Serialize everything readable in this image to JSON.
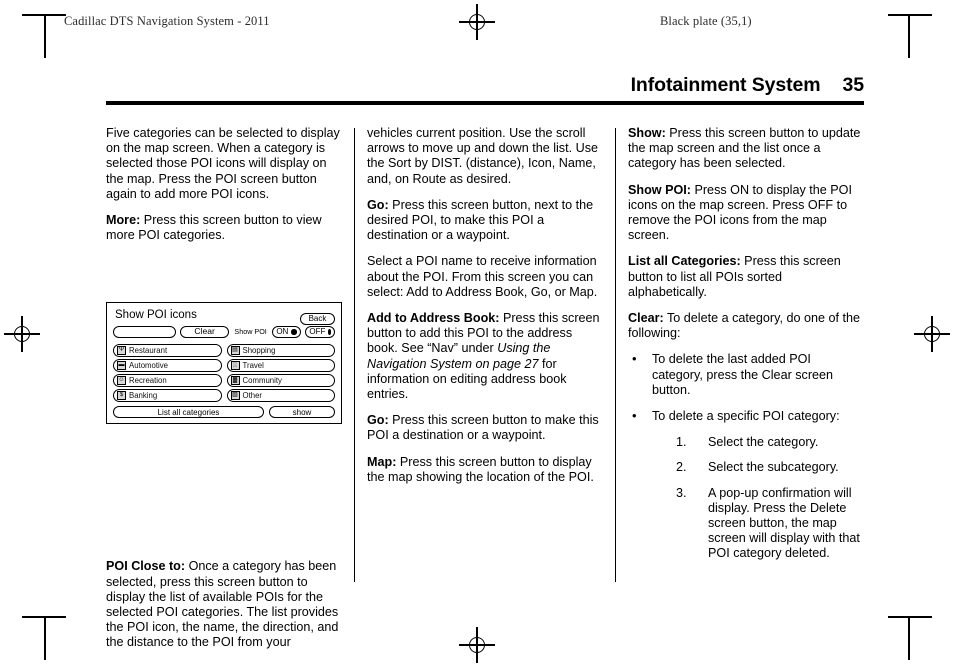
{
  "page": {
    "running_head_left": "Cadillac DTS Navigation System - 2011",
    "running_head_right": "Black plate (35,1)",
    "section_title": "Infotainment System",
    "page_number": "35"
  },
  "figure": {
    "screen_title": "Show POI icons",
    "back_button": "Back",
    "blank_field": "",
    "clear_button": "Clear",
    "show_poi_label": "Show POI",
    "on_button": "ON",
    "off_button": "OFF",
    "categories": [
      {
        "label": "Restaurant",
        "icon": "restaurant-icon",
        "glyph": "Ψ"
      },
      {
        "label": "Shopping",
        "icon": "shopping-icon",
        "glyph": "▤"
      },
      {
        "label": "Automotive",
        "icon": "automotive-icon",
        "glyph": "▬"
      },
      {
        "label": "Travel",
        "icon": "travel-icon",
        "glyph": "░"
      },
      {
        "label": "Recreation",
        "icon": "recreation-icon",
        "glyph": "☺"
      },
      {
        "label": "Community",
        "icon": "community-icon",
        "glyph": "▓"
      },
      {
        "label": "Banking",
        "icon": "banking-icon",
        "glyph": "$"
      },
      {
        "label": "Other",
        "icon": "other-icon",
        "glyph": "▧"
      }
    ],
    "list_all_button": "List all categories",
    "show_button": "show"
  },
  "column1": {
    "para1": "Five categories can be selected to display on the map screen. When a category is selected those POI icons will display on the map. Press the POI screen button again to add more POI icons.",
    "more_term": "More:",
    "more_text": " Press this screen button to view more POI categories.",
    "poi_close_term": "POI Close to:",
    "poi_close_text": " Once a category has been selected, press this screen button to display the list of available POIs for the selected POI categories. The list provides the POI icon, the name, the direction, and the distance to the POI from your"
  },
  "column2": {
    "para1": "vehicles current position. Use the scroll arrows to move up and down the list. Use the Sort by DIST. (distance), Icon, Name, and, on Route as desired.",
    "go_term": "Go:",
    "go_text": " Press this screen button, next to the desired POI, to make this POI a destination or a waypoint.",
    "para2": "Select a POI name to receive information about the POI. From this screen you can select: Add to Address Book, Go, or Map.",
    "addr_term": "Add to Address Book:",
    "addr_text_a": " Press this screen button to add this POI to the address book. See “Nav” under ",
    "addr_italic": "Using the Navigation System on page 27",
    "addr_text_b": " for information on editing address book entries.",
    "go2_term": "Go:",
    "go2_text": " Press this screen button to make this POI a destination or a waypoint.",
    "map_term": "Map:",
    "map_text": " Press this screen button to display the map showing the location of the POI."
  },
  "column3": {
    "show_term": "Show:",
    "show_text": " Press this screen button to update the map screen and the list once a category has been selected.",
    "showpoi_term": "Show POI:",
    "showpoi_text": " Press ON to display the POI icons on the map screen. Press OFF to remove the POI icons from the map screen.",
    "listall_term": "List all Categories:",
    "listall_text": " Press this screen button to list all POIs sorted alphabetically.",
    "clear_term": "Clear:",
    "clear_text": " To delete a category, do one of the following:",
    "bullet_marker": "•",
    "bullet1": "To delete the last added POI category, press the Clear screen button.",
    "bullet2": "To delete a specific POI category:",
    "steps": [
      {
        "num": "1.",
        "text": "Select the category."
      },
      {
        "num": "2.",
        "text": "Select the subcategory."
      },
      {
        "num": "3.",
        "text": "A pop-up confirmation will display. Press the Delete screen button, the map screen will display with that POI category deleted."
      }
    ]
  }
}
